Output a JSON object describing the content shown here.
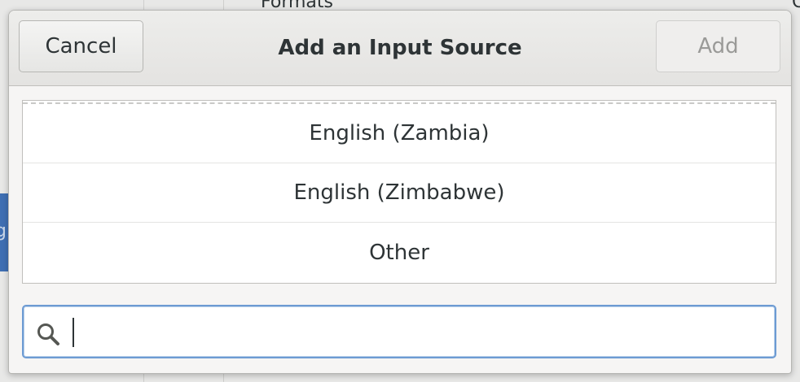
{
  "background": {
    "formats_label": "Formats",
    "right_partial_text": "C",
    "left_partial_text": "g"
  },
  "dialog": {
    "title": "Add an Input Source",
    "cancel_label": "Cancel",
    "add_label": "Add",
    "list_items": [
      {
        "label": "English (Zambia)"
      },
      {
        "label": "English (Zimbabwe)"
      },
      {
        "label": "Other"
      }
    ],
    "search": {
      "value": "",
      "placeholder": "",
      "icon": "search-icon"
    }
  },
  "colors": {
    "accent": "#6d9bd3",
    "background_blue_tab": "#3f6fb3"
  }
}
